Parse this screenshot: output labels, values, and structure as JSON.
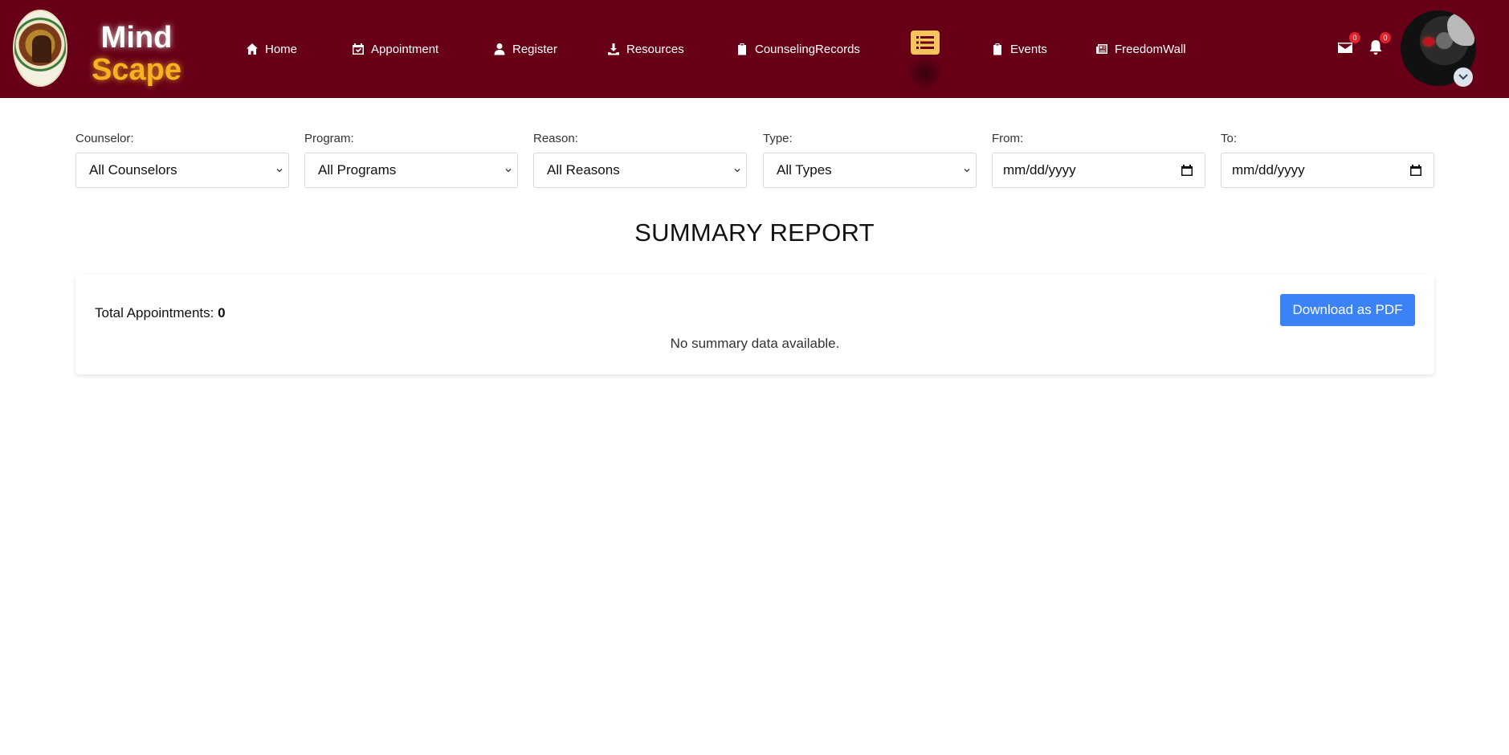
{
  "brand": {
    "line1": "Mind",
    "line2": "Scape"
  },
  "nav": [
    {
      "label": "Home",
      "icon": "home-icon"
    },
    {
      "label": "Appointment",
      "icon": "calendar-check-icon"
    },
    {
      "label": "Register",
      "icon": "user-icon"
    },
    {
      "label": "Resources",
      "icon": "download-icon"
    },
    {
      "label": "CounselingRecords",
      "icon": "clipboard-icon"
    },
    {
      "label": "Events",
      "icon": "clipboard-icon"
    },
    {
      "label": "FreedomWall",
      "icon": "newspaper-icon"
    }
  ],
  "header": {
    "messages_count": "0",
    "notifications_count": "0",
    "menu_icon": "list-icon"
  },
  "filters": {
    "counselor": {
      "label": "Counselor:",
      "value": "All Counselors"
    },
    "program": {
      "label": "Program:",
      "value": "All Programs"
    },
    "reason": {
      "label": "Reason:",
      "value": "All Reasons"
    },
    "type": {
      "label": "Type:",
      "value": "All Types"
    },
    "from": {
      "label": "From:",
      "value": "mm/dd/yyyy"
    },
    "to": {
      "label": "To:",
      "value": "mm/dd/yyyy"
    }
  },
  "report": {
    "title": "SUMMARY REPORT",
    "total_label": "Total Appointments:",
    "total_value": "0",
    "download_label": "Download as PDF",
    "empty_message": "No summary data available."
  },
  "colors": {
    "header_bg": "#670016",
    "brand_accent": "#f5b324",
    "menu_button": "#f6c45c",
    "primary_button": "#3b82f6",
    "badge": "#e0242b"
  }
}
